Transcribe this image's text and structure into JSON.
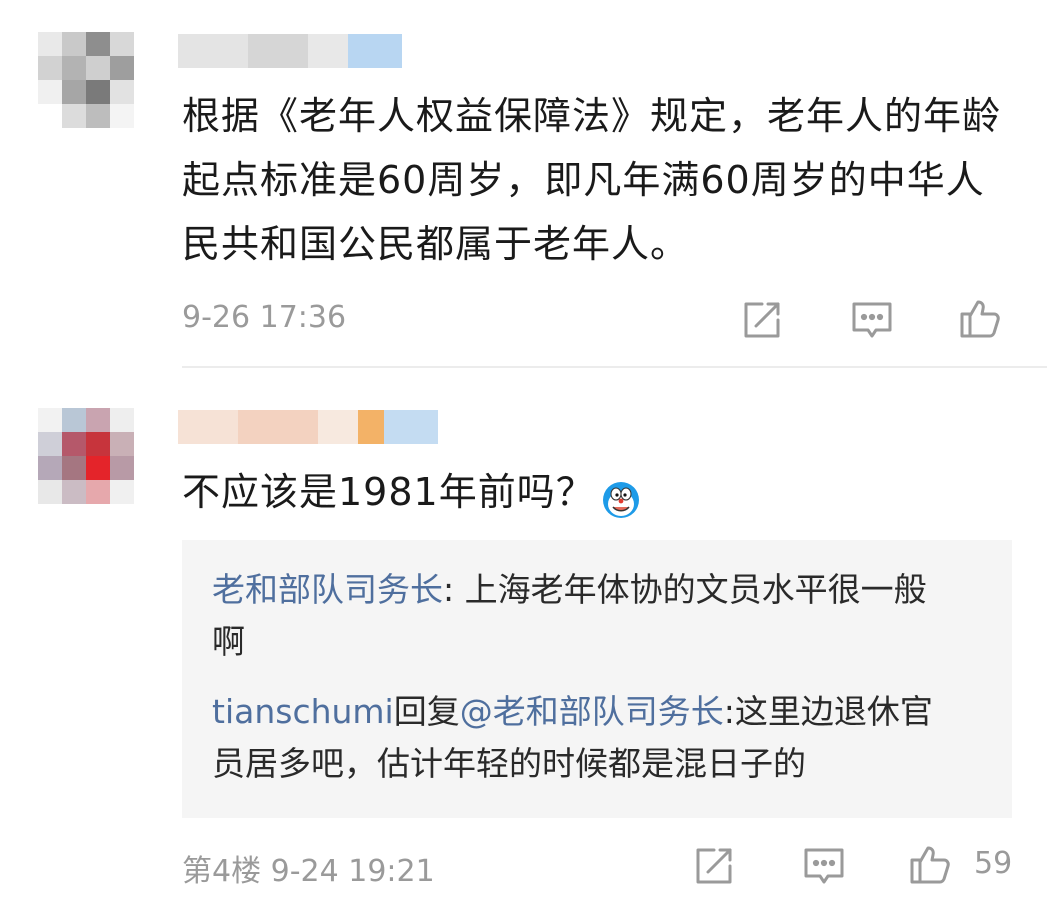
{
  "comments": [
    {
      "text": "根据《老年人权益保障法》规定，老年人的年龄起点标准是60周岁，即凡年满60周岁的中华人民共和国公民都属于老年人。",
      "time": "9-26 17:36"
    },
    {
      "text": "不应该是1981年前吗？",
      "emoji": "doraemon-emoji",
      "floor": "第4楼",
      "time": "9-24 19:21",
      "likes": "59",
      "replies": [
        {
          "author": "老和部队司务长",
          "separator": ": ",
          "text": "上海老年体协的文员水平很一般啊"
        },
        {
          "author": "tianschumi",
          "verb": "回复",
          "mention": "@老和部队司务长",
          "separator": ":",
          "text": "这里边退休官员居多吧，估计年轻的时候都是混日子的"
        }
      ]
    }
  ],
  "icons": [
    "share-icon",
    "comment-icon",
    "like-icon"
  ],
  "colors": {
    "meta": "#9a9a9a",
    "link": "#4f6f9e",
    "reply_bg": "#f5f5f5"
  }
}
